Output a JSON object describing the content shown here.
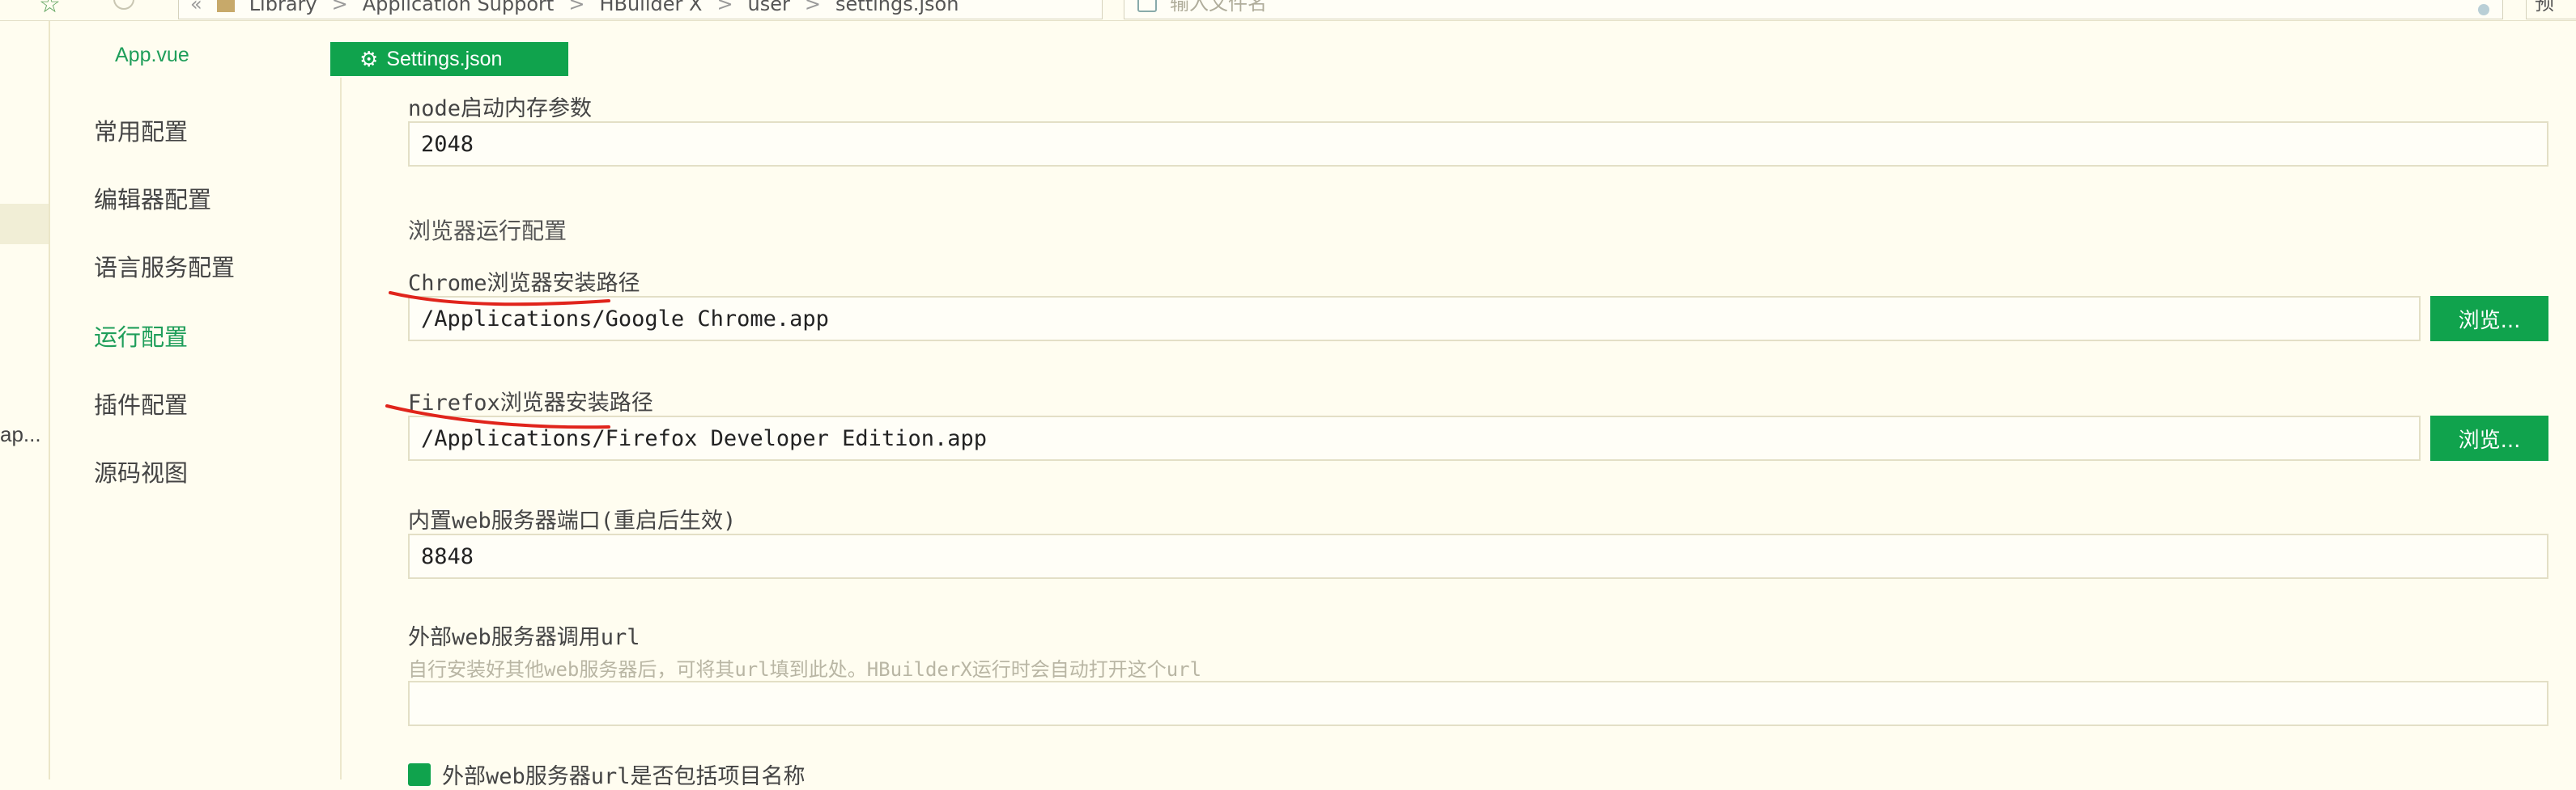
{
  "toolbar": {
    "breadcrumb": [
      "Library",
      "Application Support",
      "HBuilder X",
      "user",
      "settings.json"
    ],
    "breadcrumb_sep": ">",
    "back_sep": "«",
    "search_placeholder": "输入文件名",
    "right_truncated": "预"
  },
  "left_strip": {
    "truncated_label": "ap..."
  },
  "tabs": [
    {
      "label": "App.vue",
      "active": false
    },
    {
      "label": "Settings.json",
      "active": true
    }
  ],
  "settings_nav": {
    "items": [
      {
        "label": "常用配置",
        "active": false
      },
      {
        "label": "编辑器配置",
        "active": false
      },
      {
        "label": "语言服务配置",
        "active": false
      },
      {
        "label": "运行配置",
        "active": true
      },
      {
        "label": "插件配置",
        "active": false
      },
      {
        "label": "源码视图",
        "active": false
      }
    ]
  },
  "main": {
    "node_memory": {
      "label": "node启动内存参数",
      "value": "2048"
    },
    "browser_section": {
      "heading": "浏览器运行配置"
    },
    "chrome_path": {
      "label": "Chrome浏览器安装路径",
      "value": "/Applications/Google Chrome.app",
      "browse_label": "浏览..."
    },
    "firefox_path": {
      "label": "Firefox浏览器安装路径",
      "value": "/Applications/Firefox Developer Edition.app",
      "browse_label": "浏览..."
    },
    "web_port": {
      "label": "内置web服务器端口(重启后生效)",
      "value": "8848"
    },
    "external_url": {
      "label": "外部web服务器调用url",
      "hint": "自行安装好其他web服务器后，可将其url填到此处。HBuilderX运行时会自动打开这个url",
      "value": ""
    },
    "include_project_name": {
      "label": "外部web服务器url是否包括项目名称",
      "checked": true
    }
  },
  "colors": {
    "accent": "#10a34d",
    "background": "#fffdf0",
    "annotation": "#e0241b"
  }
}
